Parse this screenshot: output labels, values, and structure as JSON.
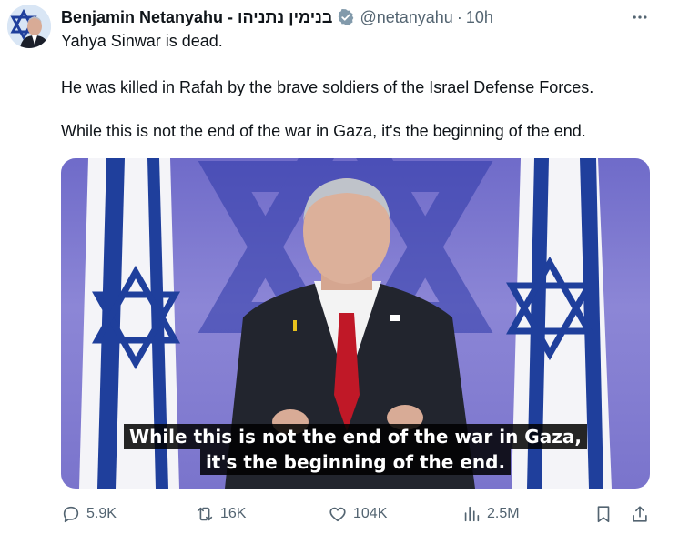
{
  "author": {
    "name": "Benjamin Netanyahu - בנימין נתניהו",
    "handle": "@netanyahu",
    "separator": "·",
    "time": "10h"
  },
  "tweet": {
    "line1": "Yahya Sinwar is dead.",
    "line2": "He was killed in Rafah by the brave soldiers of the Israel Defense Forces.",
    "line3": "While this is not the end of the war in Gaza, it's the beginning of the end."
  },
  "media": {
    "subtitle_line1": "While this is not the end of the war in Gaza,",
    "subtitle_line2": "it's the beginning of the end."
  },
  "actions": {
    "replies": "5.9K",
    "reposts": "16K",
    "likes": "104K",
    "views": "2.5M"
  },
  "icons": {
    "verified": "verified-badge-icon",
    "more": "more-icon",
    "reply": "reply-icon",
    "repost": "repost-icon",
    "like": "heart-icon",
    "views": "views-icon",
    "bookmark": "bookmark-icon",
    "share": "share-icon"
  },
  "colors": {
    "text": "#0f1419",
    "muted": "#536471",
    "verified": "#829aab",
    "flag_blue": "#1f3f9c"
  }
}
